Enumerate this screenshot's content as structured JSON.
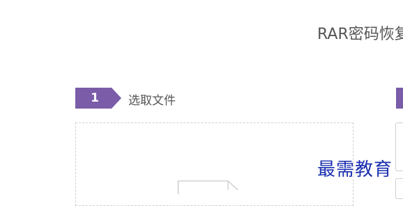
{
  "page": {
    "title": "RAR密码恢复"
  },
  "step1": {
    "number": "1",
    "label": "选取文件"
  },
  "watermark": {
    "text": "最需教育"
  },
  "colors": {
    "accent": "#7a5ca8",
    "text": "#555555",
    "dashed_border": "#d0d0d0",
    "watermark": "#1a2fb0"
  }
}
